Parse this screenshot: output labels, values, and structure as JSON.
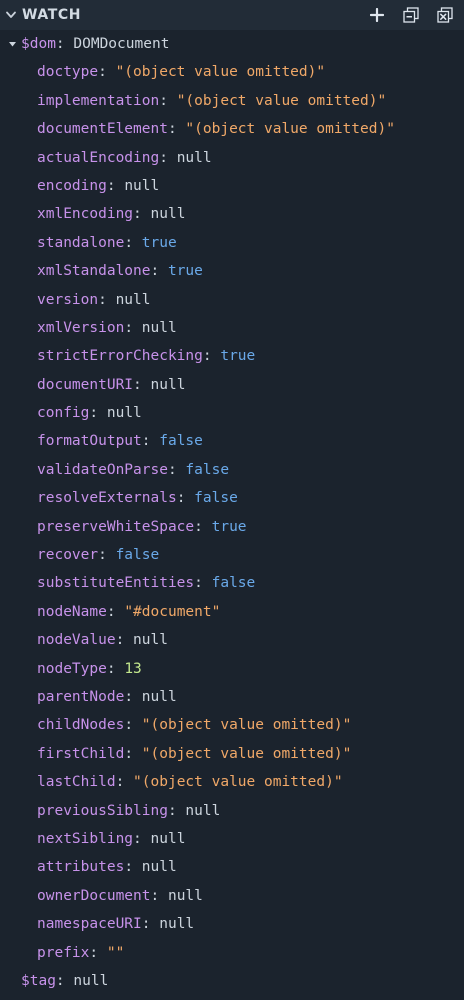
{
  "colors": {
    "background": "#1b232d",
    "header_bg": "#222c37",
    "key": "#c792ea",
    "string": "#f0a868",
    "boolean": "#6aa9e9",
    "number": "#c3e88d",
    "plain": "#cdd5de"
  },
  "header": {
    "title": "WATCH",
    "expand_icon": "chevron-down-icon",
    "actions": [
      {
        "name": "add-expression-button",
        "icon": "plus-icon"
      },
      {
        "name": "collapse-all-button",
        "icon": "collapse-all-icon"
      },
      {
        "name": "remove-all-button",
        "icon": "close-all-icon"
      }
    ]
  },
  "watch": {
    "dom": {
      "name": "$dom",
      "sep": ": ",
      "value": "DOMDocument",
      "expanded": true,
      "children": [
        {
          "key": "doctype",
          "value": "\"(object value omitted)\"",
          "type": "string"
        },
        {
          "key": "implementation",
          "value": "\"(object value omitted)\"",
          "type": "string"
        },
        {
          "key": "documentElement",
          "value": "\"(object value omitted)\"",
          "type": "string"
        },
        {
          "key": "actualEncoding",
          "value": "null",
          "type": "null"
        },
        {
          "key": "encoding",
          "value": "null",
          "type": "null"
        },
        {
          "key": "xmlEncoding",
          "value": "null",
          "type": "null"
        },
        {
          "key": "standalone",
          "value": "true",
          "type": "boolean"
        },
        {
          "key": "xmlStandalone",
          "value": "true",
          "type": "boolean"
        },
        {
          "key": "version",
          "value": "null",
          "type": "null"
        },
        {
          "key": "xmlVersion",
          "value": "null",
          "type": "null"
        },
        {
          "key": "strictErrorChecking",
          "value": "true",
          "type": "boolean"
        },
        {
          "key": "documentURI",
          "value": "null",
          "type": "null"
        },
        {
          "key": "config",
          "value": "null",
          "type": "null"
        },
        {
          "key": "formatOutput",
          "value": "false",
          "type": "boolean"
        },
        {
          "key": "validateOnParse",
          "value": "false",
          "type": "boolean"
        },
        {
          "key": "resolveExternals",
          "value": "false",
          "type": "boolean"
        },
        {
          "key": "preserveWhiteSpace",
          "value": "true",
          "type": "boolean"
        },
        {
          "key": "recover",
          "value": "false",
          "type": "boolean"
        },
        {
          "key": "substituteEntities",
          "value": "false",
          "type": "boolean"
        },
        {
          "key": "nodeName",
          "value": "\"#document\"",
          "type": "string"
        },
        {
          "key": "nodeValue",
          "value": "null",
          "type": "null"
        },
        {
          "key": "nodeType",
          "value": "13",
          "type": "number"
        },
        {
          "key": "parentNode",
          "value": "null",
          "type": "null"
        },
        {
          "key": "childNodes",
          "value": "\"(object value omitted)\"",
          "type": "string"
        },
        {
          "key": "firstChild",
          "value": "\"(object value omitted)\"",
          "type": "string"
        },
        {
          "key": "lastChild",
          "value": "\"(object value omitted)\"",
          "type": "string"
        },
        {
          "key": "previousSibling",
          "value": "null",
          "type": "null"
        },
        {
          "key": "nextSibling",
          "value": "null",
          "type": "null"
        },
        {
          "key": "attributes",
          "value": "null",
          "type": "null"
        },
        {
          "key": "ownerDocument",
          "value": "null",
          "type": "null"
        },
        {
          "key": "namespaceURI",
          "value": "null",
          "type": "null"
        },
        {
          "key": "prefix",
          "value": "\"\"",
          "type": "string"
        }
      ]
    },
    "tag": {
      "name": "$tag",
      "sep": ": ",
      "value": "null"
    }
  }
}
